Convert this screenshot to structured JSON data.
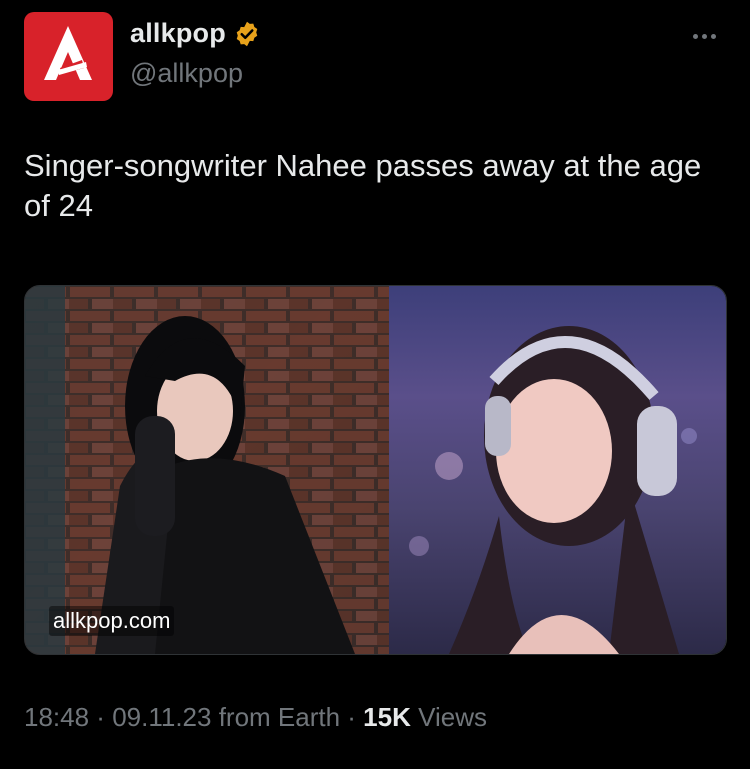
{
  "author": {
    "display_name": "allkpop",
    "handle": "@allkpop",
    "avatar_icon": "allkpop-logo-icon",
    "verified_icon": "verified-badge-icon",
    "brand_color": "#d8222a",
    "verified_color": "#e8a21b"
  },
  "tweet": {
    "text": "Singer-songwriter Nahee passes away at the age of 24",
    "media_watermark": "allkpop.com"
  },
  "meta": {
    "time": "18:48",
    "separator_1": " · ",
    "date": "09.11.23",
    "source": " from Earth",
    "separator_2": " · ",
    "views_count": "15K",
    "views_label": " Views"
  },
  "more_icon": "more-options-icon"
}
